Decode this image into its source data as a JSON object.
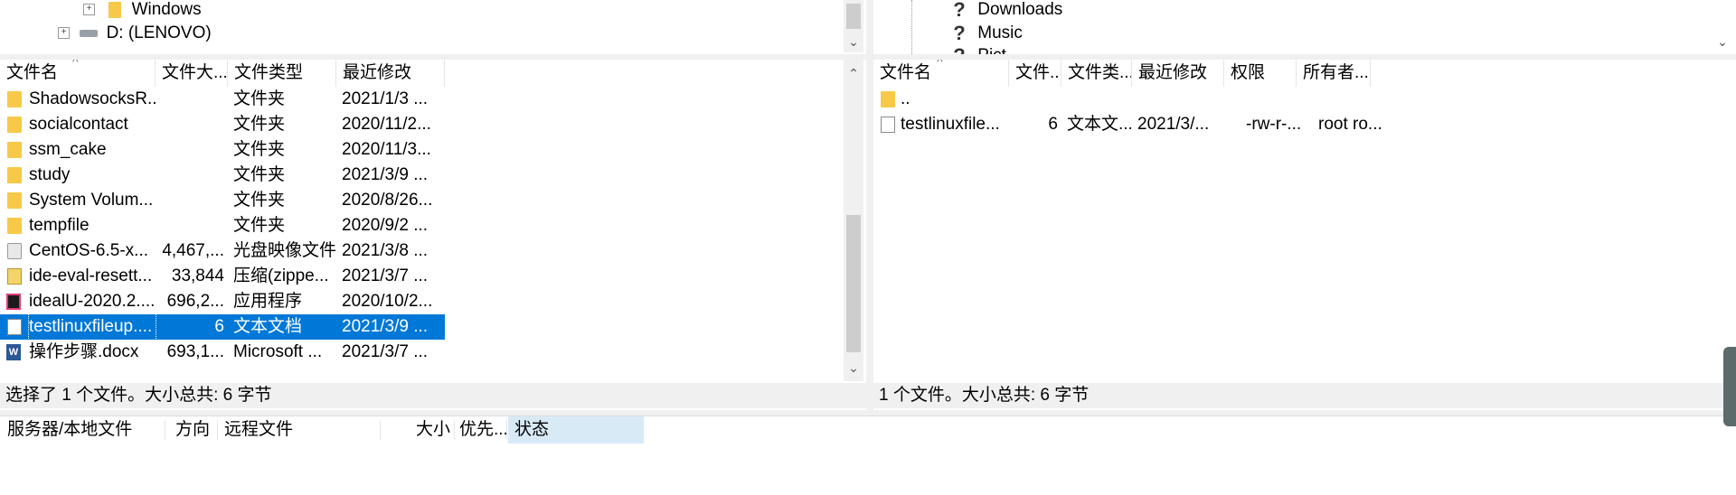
{
  "local_tree": {
    "items": [
      {
        "label": "Windows"
      },
      {
        "label": "D: (LENOVO)"
      }
    ]
  },
  "remote_tree": {
    "items": [
      {
        "label": "Downloads"
      },
      {
        "label": "Music"
      },
      {
        "label": "Pict"
      }
    ]
  },
  "local_list": {
    "columns": [
      "文件名",
      "文件大...",
      "文件类型",
      "最近修改"
    ],
    "rows": [
      {
        "name": "ShadowsocksR...",
        "size": "",
        "type": "文件夹",
        "modified": "2021/1/3 ...",
        "icon": "folder-icon"
      },
      {
        "name": "socialcontact",
        "size": "",
        "type": "文件夹",
        "modified": "2020/11/2...",
        "icon": "folder-icon"
      },
      {
        "name": "ssm_cake",
        "size": "",
        "type": "文件夹",
        "modified": "2020/11/3...",
        "icon": "folder-icon"
      },
      {
        "name": "study",
        "size": "",
        "type": "文件夹",
        "modified": "2021/3/9 ...",
        "icon": "folder-icon"
      },
      {
        "name": "System Volum...",
        "size": "",
        "type": "文件夹",
        "modified": "2020/8/26...",
        "icon": "folder-icon"
      },
      {
        "name": "tempfile",
        "size": "",
        "type": "文件夹",
        "modified": "2020/9/2 ...",
        "icon": "folder-icon"
      },
      {
        "name": "CentOS-6.5-x...",
        "size": "4,467,...",
        "type": "光盘映像文件",
        "modified": "2021/3/8 ...",
        "icon": "disc-image-icon"
      },
      {
        "name": "ide-eval-resett...",
        "size": "33,844",
        "type": "压缩(zippe...",
        "modified": "2021/3/7 ...",
        "icon": "zip-icon"
      },
      {
        "name": "idealU-2020.2....",
        "size": "696,2...",
        "type": "应用程序",
        "modified": "2020/10/2...",
        "icon": "app-icon"
      },
      {
        "name": "testlinuxfileup....",
        "size": "6",
        "type": "文本文档",
        "modified": "2021/3/9 ...",
        "icon": "text-file-icon",
        "selected": true
      },
      {
        "name": "操作步骤.docx",
        "size": "693,1...",
        "type": "Microsoft ...",
        "modified": "2021/3/7 ...",
        "icon": "word-icon"
      }
    ],
    "status": "选择了 1 个文件。大小总共: 6 字节"
  },
  "remote_list": {
    "columns": [
      "文件名",
      "文件...",
      "文件类...",
      "最近修改",
      "权限",
      "所有者..."
    ],
    "rows": [
      {
        "name": "..",
        "size": "",
        "type": "",
        "modified": "",
        "perm": "",
        "owner": "",
        "icon": "folder-icon"
      },
      {
        "name": "testlinuxfile...",
        "size": "6",
        "type": "文本文...",
        "modified": "2021/3/...",
        "perm": "-rw-r-...",
        "owner": "root ro...",
        "icon": "text-file-icon"
      }
    ],
    "status": "1 个文件。大小总共: 6 字节"
  },
  "queue": {
    "columns": [
      "服务器/本地文件",
      "方向",
      "远程文件",
      "大小",
      "优先...",
      "状态"
    ]
  },
  "colors": {
    "selection": "#0078d7",
    "status_bar": "#f0f0f0",
    "folder": "#f7c948"
  }
}
